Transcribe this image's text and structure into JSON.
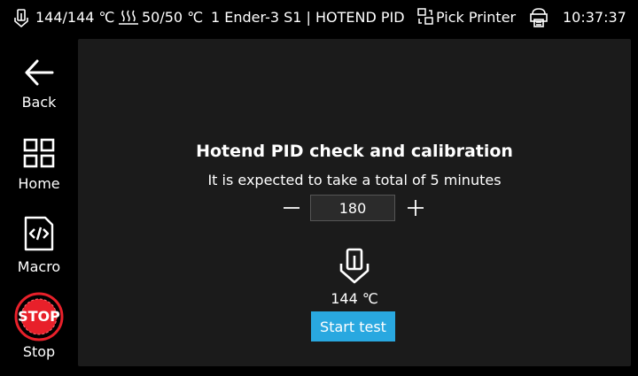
{
  "status_bar": {
    "hotend_icon": "hotend-thermometer-icon",
    "hotend_temp": "144/144 ℃",
    "bed_icon": "heated-bed-icon",
    "bed_temp": "50/50 ℃",
    "printer_title": "1 Ender-3 S1 | HOTEND PID",
    "pick_printer_icon": "switch-printer-icon",
    "pick_printer_label": "Pick Printer",
    "printer_status_icon": "printer-icon",
    "time": "10:37:37"
  },
  "sidebar": {
    "back": {
      "label": "Back",
      "icon": "back-arrow-icon"
    },
    "home": {
      "label": "Home",
      "icon": "grid-home-icon"
    },
    "macro": {
      "label": "Macro",
      "icon": "macro-code-icon"
    },
    "stop": {
      "label": "Stop",
      "icon": "stop-icon",
      "icon_text": "STOP",
      "color": "#e8202a"
    }
  },
  "main": {
    "title": "Hotend PID check and calibration",
    "subtitle": "It is expected to take a total of 5 minutes",
    "target_value": "180",
    "minus_label": "−",
    "plus_label": "+",
    "current_temp": "144 ℃",
    "start_button": "Start test",
    "accent_color": "#29a8e0"
  }
}
